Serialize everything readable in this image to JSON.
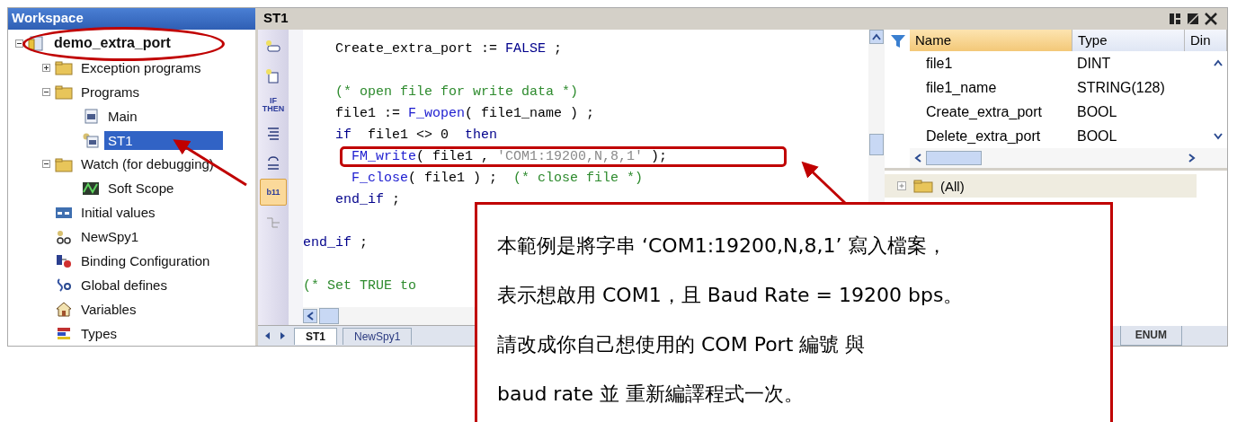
{
  "workspace": {
    "title": "Workspace",
    "tree": [
      {
        "label": "demo_extra_port",
        "kind": "project",
        "expanded": true,
        "selected": false,
        "children": [
          {
            "label": "Exception programs",
            "kind": "folder",
            "expanded": false,
            "selected": false
          },
          {
            "label": "Programs",
            "kind": "folder",
            "expanded": true,
            "selected": false,
            "children": [
              {
                "label": "Main",
                "kind": "program",
                "selected": false
              },
              {
                "label": "ST1",
                "kind": "st",
                "selected": true
              }
            ]
          },
          {
            "label": "Watch (for debugging)",
            "kind": "folder",
            "expanded": true,
            "selected": false,
            "children": [
              {
                "label": "Soft Scope",
                "kind": "scope",
                "selected": false
              }
            ]
          },
          {
            "label": "Initial values",
            "kind": "values",
            "selected": false
          },
          {
            "label": "NewSpy1",
            "kind": "spy",
            "selected": false
          },
          {
            "label": "Binding Configuration",
            "kind": "binding",
            "selected": false
          },
          {
            "label": "Global defines",
            "kind": "defines",
            "selected": false
          },
          {
            "label": "Variables",
            "kind": "house",
            "selected": false
          },
          {
            "label": "Types",
            "kind": "types",
            "selected": false
          }
        ]
      }
    ]
  },
  "editor": {
    "title": "ST1",
    "toolbar": [
      {
        "kind": "rung",
        "selected": false
      },
      {
        "kind": "block",
        "selected": false
      },
      {
        "kind": "text",
        "label": "IF THEN",
        "selected": false
      },
      {
        "kind": "lines",
        "selected": false
      },
      {
        "kind": "loop",
        "selected": false
      },
      {
        "kind": "text",
        "label": "b11",
        "selected": true
      },
      {
        "kind": "network",
        "selected": false
      }
    ],
    "lines": [
      {
        "kind": "block",
        "segments": [
          {
            "kind": "plain",
            "text": "Create_extra_port := "
          },
          {
            "kind": "keyword",
            "text": "FALSE"
          },
          {
            "kind": "plain",
            "text": " ;"
          }
        ]
      },
      {
        "kind": "blank"
      },
      {
        "kind": "block",
        "segments": [
          {
            "kind": "comment",
            "text": "(* open file for write data *)"
          }
        ]
      },
      {
        "kind": "block",
        "segments": [
          {
            "kind": "plain",
            "text": "file1 := "
          },
          {
            "kind": "func",
            "text": "F_wopen"
          },
          {
            "kind": "plain",
            "text": "( file1_name ) ;"
          }
        ]
      },
      {
        "kind": "block",
        "segments": [
          {
            "kind": "keyword",
            "text": "if"
          },
          {
            "kind": "plain",
            "text": "  file1 <> 0  "
          },
          {
            "kind": "keyword",
            "text": "then"
          }
        ]
      },
      {
        "kind": "inner",
        "highlighted": true,
        "segments": [
          {
            "kind": "func",
            "text": "FM_write"
          },
          {
            "kind": "plain",
            "text": "( file1 , "
          },
          {
            "kind": "string",
            "text": "'COM1:19200,N,8,1'"
          },
          {
            "kind": "plain",
            "text": " );"
          }
        ]
      },
      {
        "kind": "inner",
        "highlighted": false,
        "segments": [
          {
            "kind": "func",
            "text": "F_close"
          },
          {
            "kind": "plain",
            "text": "( file1 ) ;  "
          },
          {
            "kind": "comment",
            "text": "(* close file *)"
          }
        ]
      },
      {
        "kind": "block",
        "segments": [
          {
            "kind": "keyword",
            "text": "end_if"
          },
          {
            "kind": "plain",
            "text": " ;"
          }
        ]
      },
      {
        "kind": "blank"
      },
      {
        "kind": "outer",
        "segments": [
          {
            "kind": "keyword",
            "text": "end_if"
          },
          {
            "kind": "plain",
            "text": " ;"
          }
        ]
      },
      {
        "kind": "blank"
      },
      {
        "kind": "outer",
        "segments": [
          {
            "kind": "comment",
            "text": "(* Set TRUE to"
          }
        ]
      }
    ],
    "tabs": [
      {
        "label": "ST1",
        "selected": true
      },
      {
        "label": "NewSpy1",
        "selected": false
      }
    ]
  },
  "variables": {
    "columns": [
      "Name",
      "Type",
      "Din"
    ],
    "rows": [
      [
        "file1",
        "DINT"
      ],
      [
        "file1_name",
        "STRING(128)"
      ],
      [
        "Create_extra_port",
        "BOOL"
      ],
      [
        "Delete_extra_port",
        "BOOL"
      ]
    ],
    "group": "(All)",
    "tabs": [
      "ENUM"
    ]
  },
  "callout": {
    "lines": [
      "本範例是將字串 ‘COM1:19200,N,8,1’ 寫入檔案，",
      "表示想啟用 COM1，且 Baud Rate = 19200 bps。",
      "請改成你自己想使用的 COM Port 編號 與",
      "baud rate 並 重新編譯程式一次。"
    ]
  }
}
